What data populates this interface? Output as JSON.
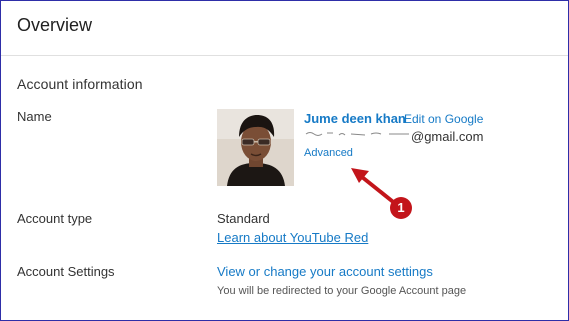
{
  "header": {
    "title": "Overview"
  },
  "account_information": {
    "section_title": "Account information",
    "name": {
      "label": "Name",
      "display_name": "Jume deen khan",
      "edit_link": "Edit on Google",
      "email_domain": "@gmail.com",
      "advanced_link": "Advanced"
    },
    "account_type": {
      "label": "Account type",
      "value": "Standard",
      "learn_link": "Learn about YouTube Red"
    },
    "account_settings": {
      "label": "Account Settings",
      "link": "View or change your account settings",
      "note": "You will be redirected to your Google Account page"
    }
  },
  "annotation": {
    "badge_number": "1",
    "color": "#c3151b"
  },
  "colors": {
    "link": "#167ac6",
    "frame_border": "#2e2ea8",
    "divider": "#e0e0e0"
  },
  "icons": {
    "avatar": "profile-photo",
    "arrow": "annotation-arrow"
  }
}
